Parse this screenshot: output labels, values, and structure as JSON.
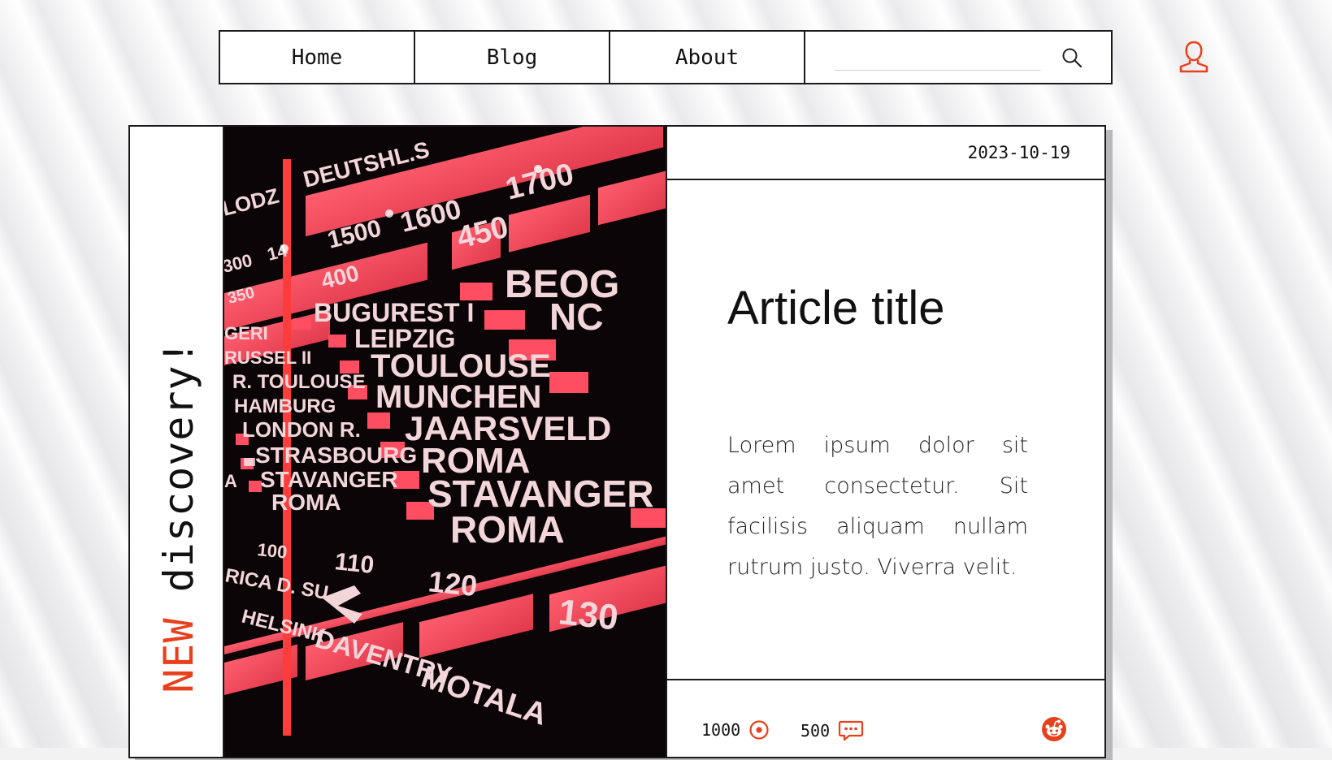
{
  "nav": {
    "items": [
      {
        "label": "Home"
      },
      {
        "label": "Blog"
      },
      {
        "label": "About"
      }
    ],
    "search": {
      "value": "",
      "placeholder": ""
    },
    "icons": {
      "search": "search-icon",
      "user": "user-icon"
    }
  },
  "article": {
    "side_label": {
      "highlight": "NEW",
      "rest": " discovery!"
    },
    "date": "2023-10-19",
    "title": "Article title",
    "body": "Lorem ipsum dolor sit amet consectetur. Sit facilisis aliquam nullam rutrum justo. Viverra velit.",
    "views": "1000",
    "comments": "500",
    "image_labels": {
      "rows": [
        "DEUTSHL.S",
        "LODZ",
        "1500",
        "1600",
        "1700",
        "300",
        "14",
        "400",
        "450",
        "350",
        "BEOG",
        "NC",
        "BUGUREST I",
        "LEIPZIG",
        "GERI",
        "RUSSEL II",
        "R. TOULOUSE",
        "TOULOUSE",
        "HAMBURG",
        "MUNCHEN",
        "LONDON R.",
        "JAARSVELD",
        "STRASBOURG",
        "ROMA",
        "A",
        "STAVANGER",
        "ROMA",
        "STAVANGER",
        "ROMA",
        "100",
        "110",
        "120",
        "130",
        "RICA D. SU",
        "HELSINK",
        "DAVENTRY",
        "MOTALA"
      ]
    }
  },
  "colors": {
    "accent": "#e8401c",
    "dial": "#f0465a",
    "border": "#1a1a1a"
  }
}
